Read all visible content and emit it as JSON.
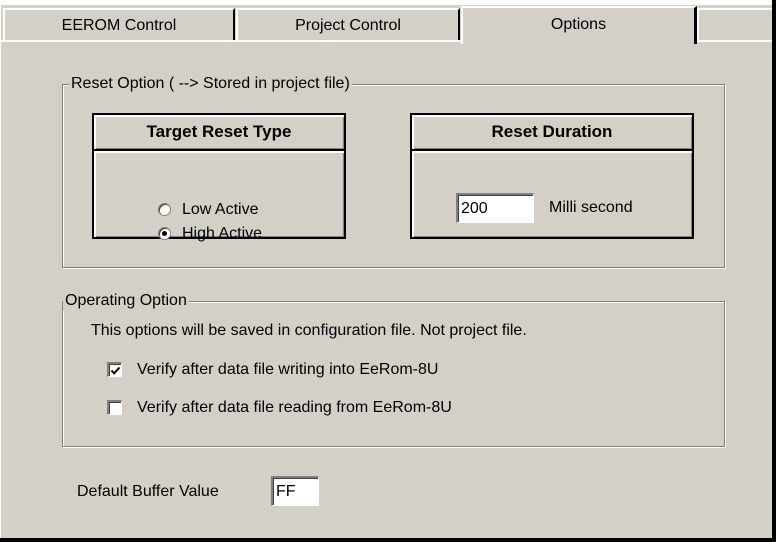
{
  "tabs": [
    {
      "label": "EEROM Control",
      "active": false
    },
    {
      "label": "Project Control",
      "active": false
    },
    {
      "label": "Options",
      "active": true
    }
  ],
  "reset_option": {
    "legend": "Reset Option ( --> Stored in project file)",
    "target_reset_type": {
      "title": "Target Reset Type",
      "options": [
        {
          "label": "Low Active",
          "selected": false
        },
        {
          "label": "High Active",
          "selected": true
        }
      ]
    },
    "reset_duration": {
      "title": "Reset Duration",
      "value": "200",
      "unit": "Milli second"
    }
  },
  "operating_option": {
    "legend": "Operating Option",
    "note": "This options will be saved in configuration file. Not project file.",
    "checks": [
      {
        "label": "Verify after data file writing  into  EeRom-8U",
        "checked": true
      },
      {
        "label": "Verify after data file reading from  EeRom-8U",
        "checked": false
      }
    ]
  },
  "default_buffer": {
    "label": "Default Buffer Value",
    "value": "FF"
  }
}
